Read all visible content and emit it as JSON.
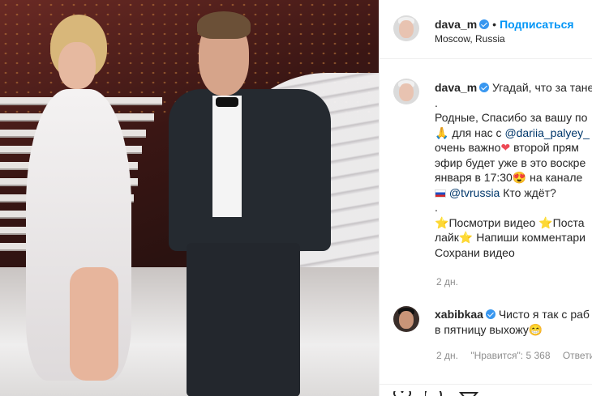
{
  "post": {
    "author": {
      "username": "dava_m",
      "follow_label": "Подписаться",
      "separator": "•",
      "location": "Moscow, Russia"
    },
    "caption_lines": [
      "Угадай, что за тане",
      ".",
      "Родные, Спасибо за вашу по",
      "для нас с",
      "@dariia_palyey_",
      "очень важно",
      "второй прям",
      "эфир будет уже в это воскре",
      "января в 17:30",
      "на канале ",
      "@tvrussia",
      "Кто ждёт?",
      ".",
      "Посмотри видео",
      "Поста",
      "лайк",
      "Напиши комментари",
      "Сохрани видео"
    ],
    "caption_time": "2 дн.",
    "comment": {
      "username": "xabibkaa",
      "text_line1": "Чисто я так с раб",
      "text_line2": "в пятницу выхожу",
      "time": "2 дн.",
      "likes": "\"Нравится\": 5 368",
      "reply": "Ответи"
    }
  },
  "icons": {
    "verified": "verified-badge-icon",
    "pray": "folded-hands-emoji",
    "heart": "red-heart-emoji",
    "heart_eyes": "heart-eyes-emoji",
    "flag": "russia-flag-emoji",
    "star": "star-emoji",
    "grin": "grinning-emoji"
  },
  "colors": {
    "link_blue": "#0095f6",
    "mention": "#00376b",
    "verified": "#3897f0",
    "muted": "#8e8e8e"
  }
}
